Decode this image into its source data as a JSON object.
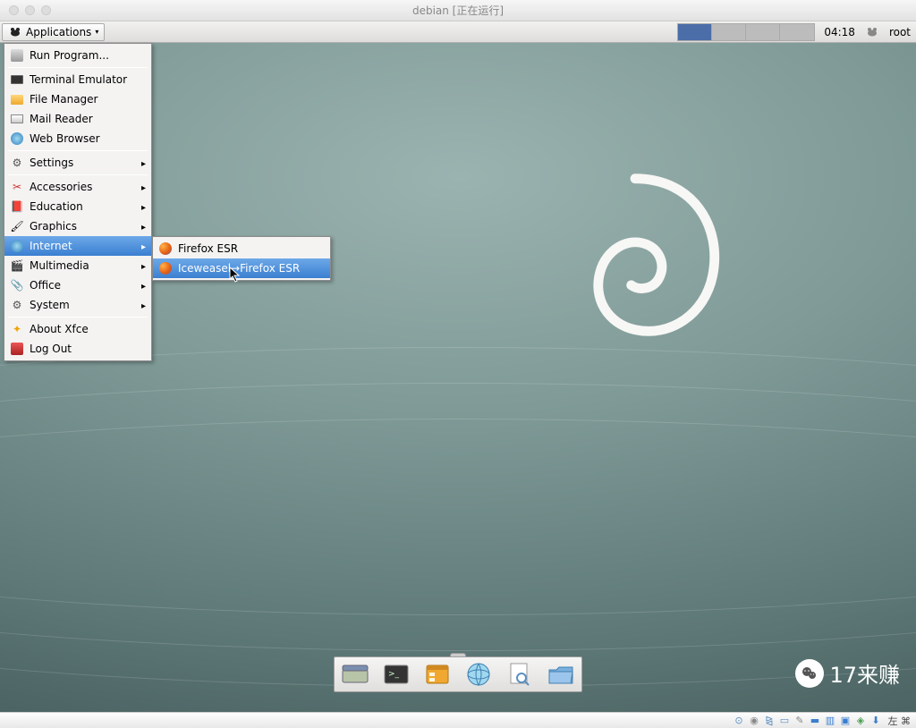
{
  "host": {
    "title": "debian [正在运行]"
  },
  "panel": {
    "apps_label": "Applications",
    "clock": "04:18",
    "user": "root"
  },
  "menu": {
    "run": "Run Program...",
    "terminal": "Terminal Emulator",
    "filemanager": "File Manager",
    "mail": "Mail Reader",
    "web": "Web Browser",
    "settings": "Settings",
    "accessories": "Accessories",
    "education": "Education",
    "graphics": "Graphics",
    "internet": "Internet",
    "multimedia": "Multimedia",
    "office": "Office",
    "system": "System",
    "about": "About Xfce",
    "logout": "Log Out"
  },
  "submenu": {
    "firefox": "Firefox ESR",
    "iceweasel": "Iceweasel→Firefox ESR"
  },
  "bottom_tray": {
    "lang": "左 ⌘"
  },
  "watermark": {
    "text": "17来赚"
  }
}
